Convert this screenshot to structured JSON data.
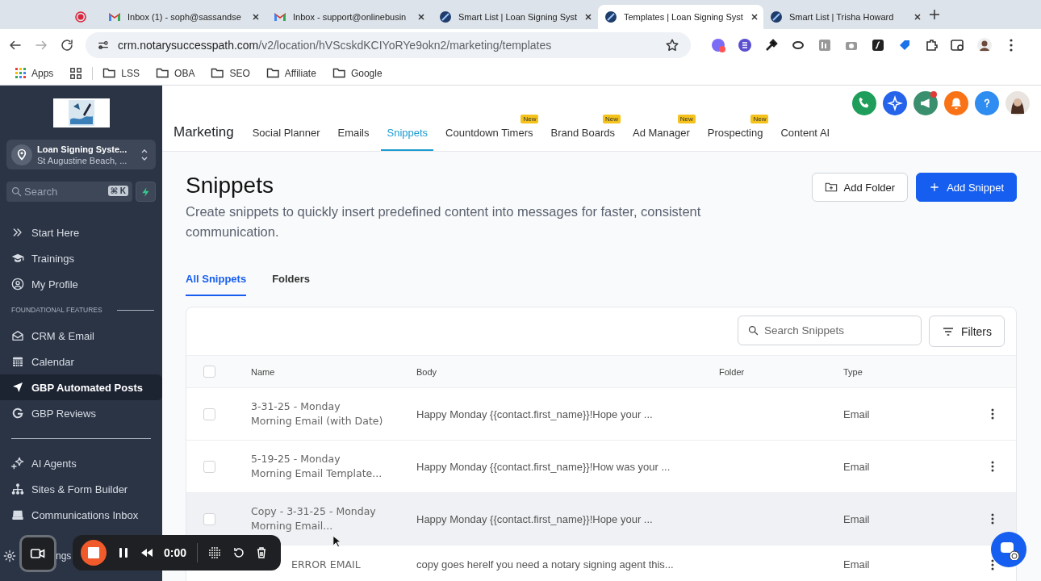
{
  "browser": {
    "tabs": [
      {
        "kind": "recording",
        "selected": false
      },
      {
        "kind": "gmail",
        "title": "Inbox (1) - soph@sassandse",
        "selected": false
      },
      {
        "kind": "gmail",
        "title": "Inbox - support@onlinebusin",
        "selected": false
      },
      {
        "kind": "site",
        "title": "Smart List | Loan Signing Syst",
        "selected": false
      },
      {
        "kind": "site",
        "title": "Templates | Loan Signing Syst",
        "selected": true
      },
      {
        "kind": "site",
        "title": "Smart List | Trisha Howard",
        "selected": false
      }
    ],
    "url_host": "crm.notarysuccesspath.com",
    "url_path": "/v2/location/hVScskdKCIYoRYe9okn2/marketing/templates",
    "bookmarks": [
      {
        "kind": "apps",
        "label": "Apps"
      },
      {
        "kind": "grid"
      },
      {
        "kind": "folder",
        "label": "LSS"
      },
      {
        "kind": "folder",
        "label": "OBA"
      },
      {
        "kind": "folder",
        "label": "SEO"
      },
      {
        "kind": "folder",
        "label": "Affiliate"
      },
      {
        "kind": "folder",
        "label": "Google"
      }
    ]
  },
  "sidebar": {
    "account": {
      "name": "Loan Signing Syste...",
      "location": "St Augustine Beach, ..."
    },
    "search": {
      "placeholder": "Search",
      "shortcut": "⌘ K"
    },
    "sections": [
      {
        "items": [
          {
            "kind": "chevrons",
            "label": "Start Here",
            "selected": false
          },
          {
            "kind": "cap",
            "label": "Trainings",
            "selected": false
          },
          {
            "kind": "user",
            "label": "My Profile",
            "selected": false
          }
        ]
      },
      {
        "title": "FOUNDATIONAL FEATURES",
        "items": [
          {
            "kind": "mail",
            "label": "CRM & Email",
            "selected": false
          },
          {
            "kind": "calendar",
            "label": "Calendar",
            "selected": false
          },
          {
            "kind": "nav",
            "label": "GBP Automated Posts",
            "selected": true
          },
          {
            "kind": "google",
            "label": "GBP Reviews",
            "selected": false
          }
        ]
      },
      {
        "items": [
          {
            "kind": "sparkle",
            "label": "AI Agents",
            "selected": false
          },
          {
            "kind": "sitemap",
            "label": "Sites & Form Builder",
            "selected": false
          },
          {
            "kind": "inbox",
            "label": "Communications Inbox",
            "selected": false
          }
        ]
      }
    ],
    "footer_label": "ngs"
  },
  "header": {
    "title": "Marketing",
    "nav": [
      {
        "label": "Social Planner",
        "selected": false
      },
      {
        "label": "Emails",
        "selected": false
      },
      {
        "label": "Snippets",
        "selected": true
      },
      {
        "label": "Countdown Timers",
        "selected": false,
        "badge": "New"
      },
      {
        "label": "Brand Boards",
        "selected": false,
        "badge": "New"
      },
      {
        "label": "Ad Manager",
        "selected": false,
        "badge": "New"
      },
      {
        "label": "Prospecting",
        "selected": false,
        "badge": "New"
      },
      {
        "label": "Content AI",
        "selected": false
      }
    ]
  },
  "page": {
    "title": "Snippets",
    "description": "Create snippets to quickly insert predefined content into messages for faster, consistent communication.",
    "add_folder": "Add Folder",
    "add_snippet": "Add Snippet",
    "tabs": [
      {
        "label": "All Snippets",
        "selected": true
      },
      {
        "label": "Folders",
        "selected": false
      }
    ],
    "search": {
      "placeholder": "Search Snippets"
    },
    "filters": "Filters",
    "all_checked": false,
    "columns": [
      "Name",
      "Body",
      "Folder",
      "Type"
    ],
    "rows": [
      {
        "name": "3-31-25 - Monday Morning Email (with Date)",
        "body": "Happy Monday {{contact.first_name}}!Hope your ...",
        "type": "Email",
        "checked": false,
        "highlighted": false
      },
      {
        "name": "5-19-25 - Monday Morning Email Template...",
        "body": "Happy Monday {{contact.first_name}}!How was your ...",
        "type": "Email",
        "checked": false,
        "highlighted": false
      },
      {
        "name": "Copy - 3-31-25 - Monday Morning Email...",
        "body": "Happy Monday {{contact.first_name}}!Hope your ...",
        "type": "Email",
        "checked": false,
        "highlighted": true
      },
      {
        "name": "ERROR EMAIL",
        "body": "copy goes herelf you need a notary signing agent this...",
        "type": "Email",
        "highlighted": false
      }
    ]
  },
  "recorder": {
    "time": "0:00"
  }
}
